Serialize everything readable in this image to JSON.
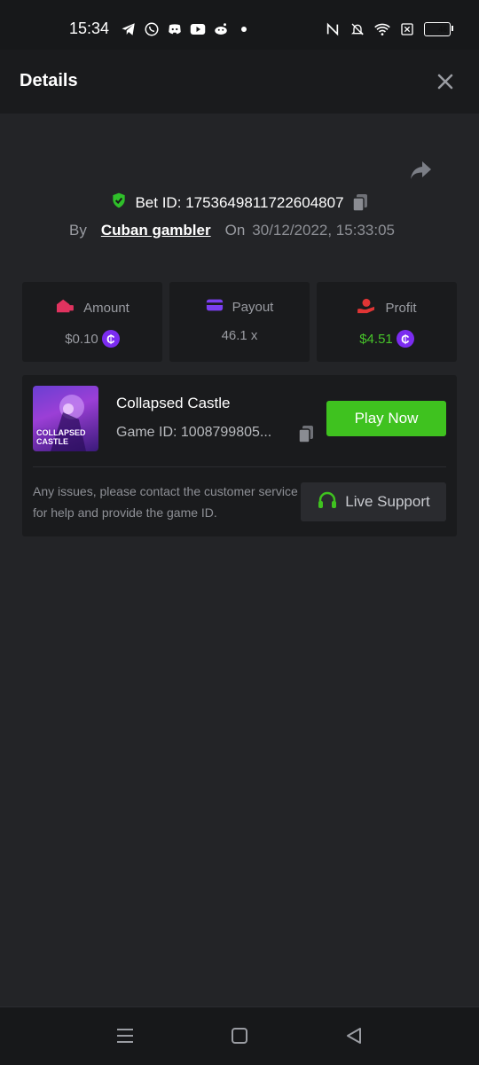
{
  "status_bar": {
    "time": "15:34",
    "battery": "46"
  },
  "header": {
    "title": "Details"
  },
  "bet": {
    "id_label": "Bet ID: 1753649811722604807",
    "by_label": "By",
    "user": "Cuban gambler",
    "on_label": "On",
    "date": "30/12/2022, 15:33:05"
  },
  "stats": {
    "amount_label": "Amount",
    "amount_value": "$0.10",
    "payout_label": "Payout",
    "payout_value": "46.1 x",
    "profit_label": "Profit",
    "profit_value": "$4.51",
    "coin_symbol": "₵"
  },
  "game": {
    "name": "Collapsed Castle",
    "id_text": "Game ID: 1008799805...",
    "thumb_text_1": "COLLAPSED",
    "thumb_text_2": "CASTLE",
    "play_label": "Play Now",
    "support_text": "Any issues, please contact the customer service for help and provide the game ID.",
    "live_support_label": "Live Support"
  },
  "colors": {
    "accent_green": "#3fc21f",
    "profit_green": "#47c32a",
    "coin_purple": "#7b2cf0",
    "shield_green": "#2fbf2a"
  }
}
